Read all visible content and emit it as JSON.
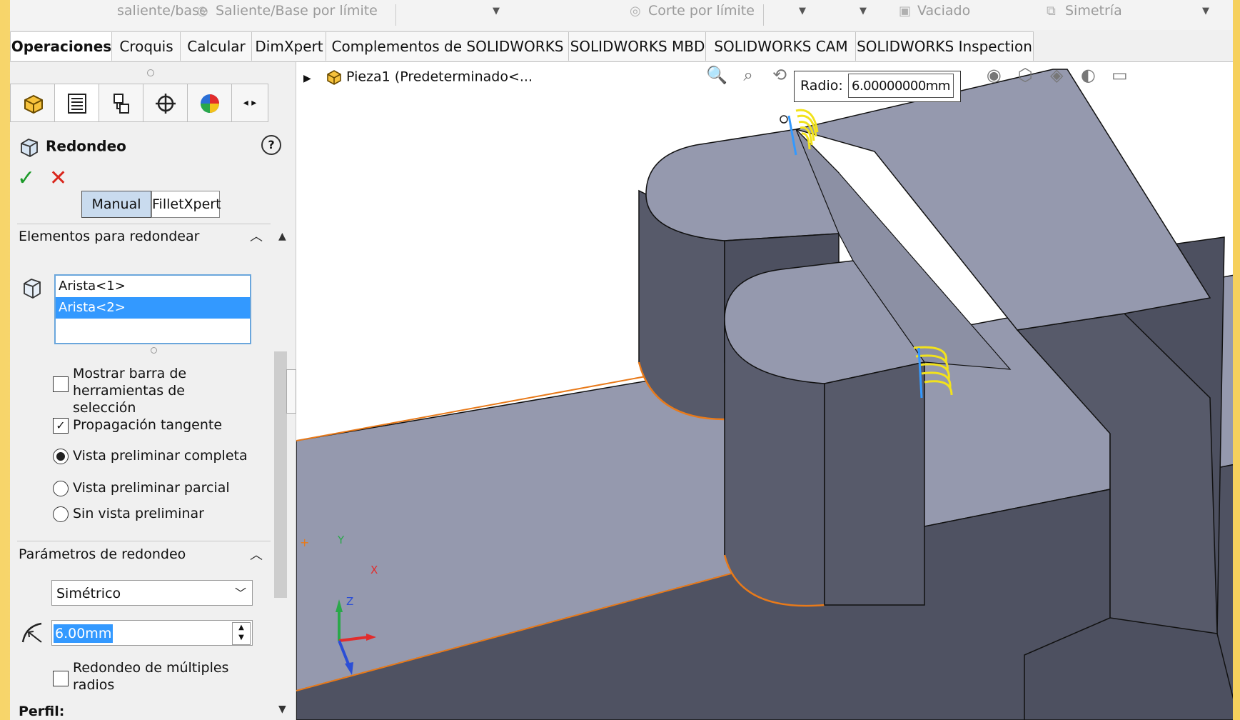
{
  "command_strip": {
    "items": [
      "saliente/base",
      "Saliente/Base por límite",
      "Corte por límite",
      "Vaciado",
      "Simetría"
    ]
  },
  "tabs": [
    {
      "label": "Operaciones",
      "active": true
    },
    {
      "label": "Croquis"
    },
    {
      "label": "Calcular"
    },
    {
      "label": "DimXpert"
    },
    {
      "label": "Complementos de SOLIDWORKS"
    },
    {
      "label": "SOLIDWORKS MBD"
    },
    {
      "label": "SOLIDWORKS CAM"
    },
    {
      "label": "SOLIDWORKS Inspection"
    }
  ],
  "feature_tabs": [
    "feature-manager-icon",
    "property-manager-icon",
    "configuration-manager-icon",
    "dimxpert-icon",
    "display-manager-icon"
  ],
  "property_manager": {
    "title": "Redondeo",
    "help": "?",
    "ok_symbol": "✓",
    "cancel_symbol": "✕",
    "modes": [
      "Manual",
      "FilletXpert"
    ],
    "active_mode": "Manual",
    "items_section": {
      "title": "Elementos para redondear",
      "edges": [
        "Arista<1>",
        "Arista<2>"
      ],
      "selected_edge": "Arista<2>",
      "options": [
        {
          "type": "checkbox",
          "label": "Mostrar barra de herramientas de selección",
          "checked": false
        },
        {
          "type": "checkbox",
          "label": "Propagación tangente",
          "checked": true
        },
        {
          "type": "radio",
          "label": "Vista preliminar completa",
          "checked": true
        },
        {
          "type": "radio",
          "label": "Vista preliminar parcial",
          "checked": false
        },
        {
          "type": "radio",
          "label": "Sin vista preliminar",
          "checked": false
        }
      ]
    },
    "params_section": {
      "title": "Parámetros de redondeo",
      "method": "Simétrico",
      "radius": "6.00mm",
      "multi_radius_label": "Redondeo de múltiples radios",
      "multi_radius_checked": false
    },
    "next_section": "Perfil:"
  },
  "viewport": {
    "tree_item": "Pieza1  (Predeterminado<...",
    "radius_callout": {
      "label": "Radio:",
      "value": "6.00000000mm"
    },
    "triad": {
      "x": "X",
      "y": "Y",
      "z": "Z"
    }
  },
  "colors": {
    "accent": "#3399ff",
    "fillet_preview": "#f2e21c",
    "edge_highlight": "#e87a1a",
    "model_top": "#9599ae",
    "model_side": "#575a6a",
    "model_dark": "#4a4d5c"
  }
}
